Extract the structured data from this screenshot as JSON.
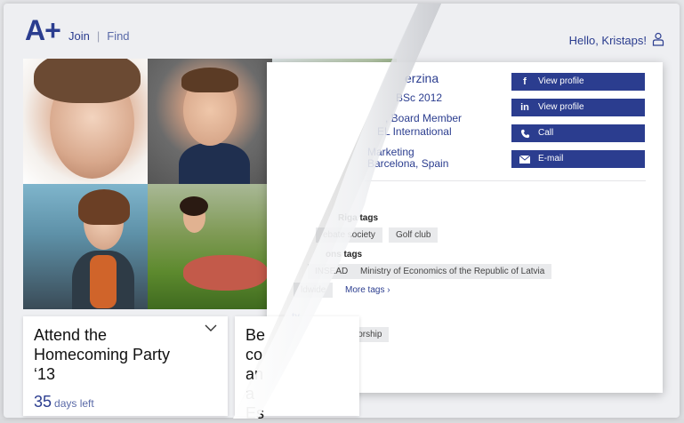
{
  "header": {
    "logo": "A+",
    "nav": [
      {
        "label": "Join"
      },
      {
        "label": "Find"
      }
    ],
    "nav_separator": "|",
    "greeting": "Hello, Kristaps!"
  },
  "profile": {
    "name": "erzina",
    "degree": "BSc 2012",
    "role": ", Board Member",
    "company": "EL International",
    "field": "Marketing",
    "location": "Barcelona, Spain",
    "actions": [
      {
        "icon": "facebook-icon",
        "label": "View profile"
      },
      {
        "icon": "linkedin-icon",
        "label": "View profile"
      },
      {
        "icon": "phone-icon",
        "label": "Call"
      },
      {
        "icon": "email-icon",
        "label": "E-mail"
      }
    ],
    "sections": [
      {
        "title": "Riga tags",
        "tags": [
          "ebate society",
          "Golf club"
        ]
      },
      {
        "title": "ons tags",
        "tags": [
          "INSEAD",
          "Ministry of Economics of the Republic of Latvia",
          "ldwide"
        ],
        "more": "More tags"
      },
      {
        "title": "ty",
        "tags": [
          "mecoming",
          "Mentorship"
        ]
      }
    ]
  },
  "events": [
    {
      "title": "Attend the Homecoming Party ‘13",
      "days": "35",
      "days_unit": "days left"
    },
    {
      "title": "Beco ana Es"
    }
  ],
  "colors": {
    "brand": "#2b3d8f",
    "tag_bg": "#e9eaec"
  }
}
